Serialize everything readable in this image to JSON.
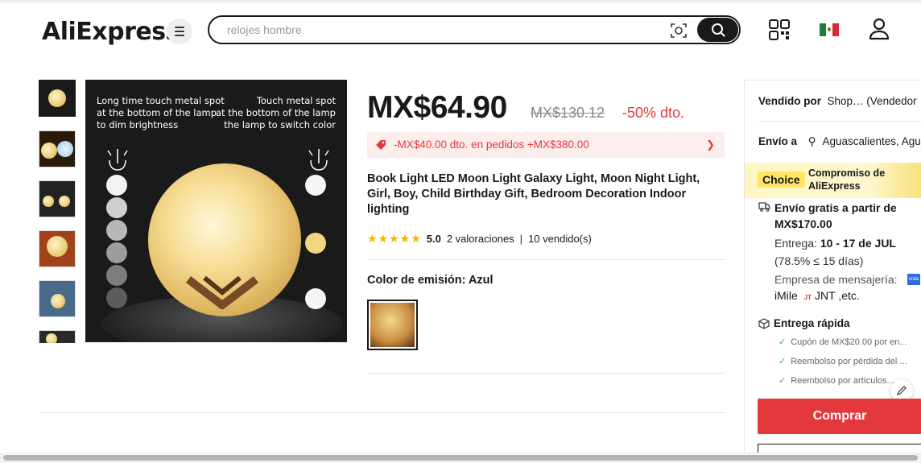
{
  "header": {
    "logo": "AliExpress",
    "search_placeholder": "relojes hombre",
    "flag": "mx-flag-icon"
  },
  "gallery": {
    "main_image_text_left": "Long time touch metal spot at the bottom of the lamp to dim brightness",
    "main_image_text_left_lines": [
      "Long time touch metal spot",
      "at the bottom of the lamp",
      "to dim brightness"
    ],
    "main_image_text_right_lines": [
      "Touch metal spot",
      "at the bottom of the lamp",
      "the lamp to switch color"
    ]
  },
  "product": {
    "price": "MX$64.90",
    "old_price": "MX$130.12",
    "discount": "-50% dto.",
    "coupon": "-MX$40.00 dto. en pedidos +MX$380.00",
    "title": "Book Light LED Moon Light Galaxy Light, Moon Night Light, Girl, Boy, Child Birthday Gift, Bedroom Decoration Indoor lighting",
    "rating": "5.0",
    "reviews": "2 valoraciones",
    "sold": "10 vendido(s)",
    "color_label": "Color de emisión: Azul"
  },
  "panel": {
    "sold_by_label": "Vendido por",
    "sold_by_value": "Shop… (Vendedor",
    "ship_to_label": "Envío a",
    "ship_to_value": "Aguascalientes, Agu",
    "choice_badge": "Choice",
    "choice_text_1": "Compromiso de",
    "choice_text_2": "AliExpress",
    "free_shipping": "Envío gratis a partir de MX$170.00",
    "delivery_label": "Entrega:",
    "delivery_dates": "10 - 17 de JUL",
    "delivery_rate": "(78.5% ≤ 15 días)",
    "carrier_label": "Empresa de mensajería:",
    "carrier_1": "iMile",
    "carrier_2": "JNT ,etc.",
    "fast_delivery": "Entrega rápida",
    "checks": [
      "Cupón de MX$20.00 por en...",
      "Reembolso por pérdida del ...",
      "Reembolso por artículos..."
    ],
    "buy_button": "Comprar"
  },
  "colors": {
    "accent_red": "#e4393c",
    "star_yellow": "#f5b400",
    "choice_yellow": "#ffe566"
  }
}
